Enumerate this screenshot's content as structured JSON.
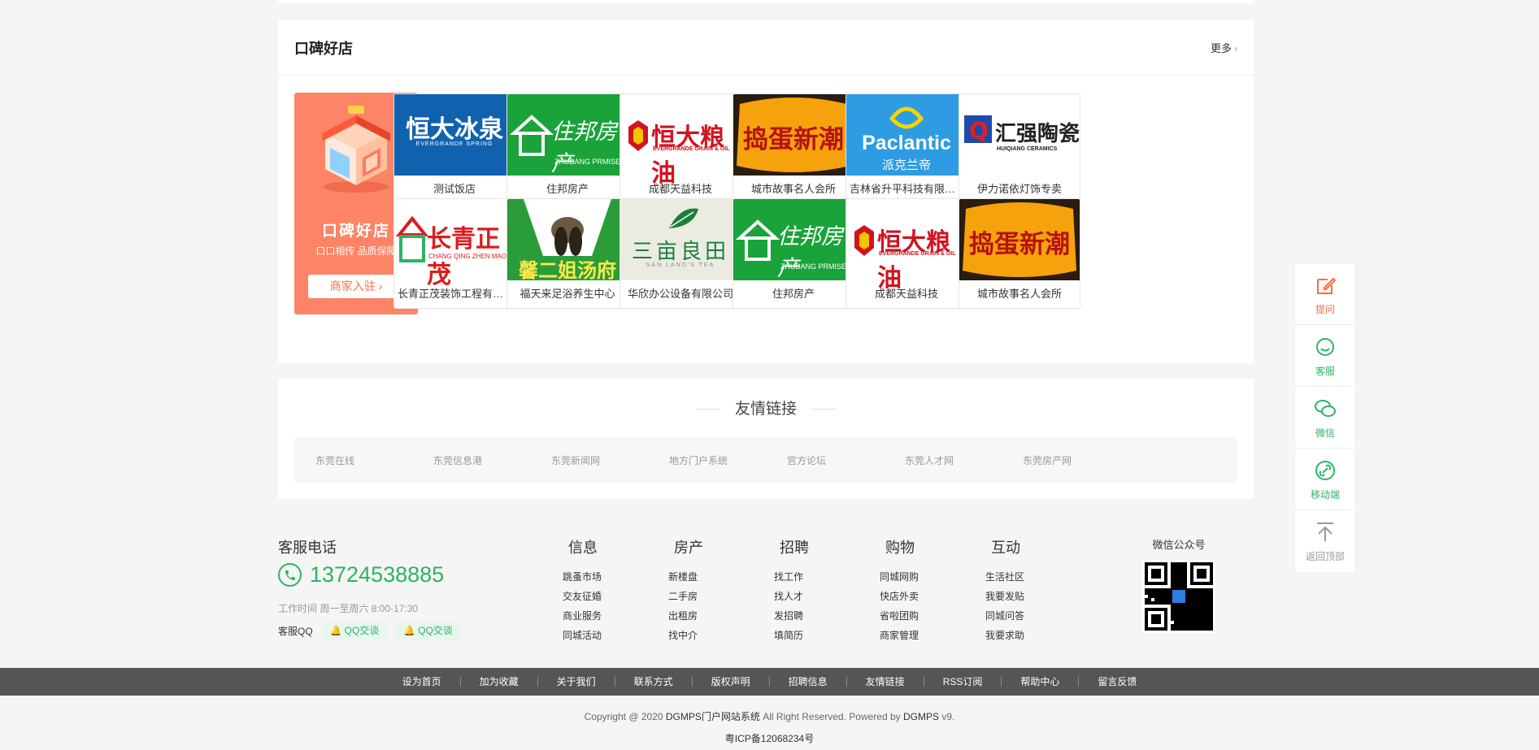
{
  "stores": {
    "title": "口碑好店",
    "more": "更多",
    "promo": {
      "title": "口碑好店",
      "subtitle": "口口相传 品质保障",
      "button": "商家入驻 ›"
    },
    "items": [
      {
        "name": "测试饭店",
        "logo": "恒大冰泉",
        "logo_sub": "EVERGRANDE SPRING",
        "bg": "#1162ae",
        "fg": "#ffffff",
        "kind": "ebq"
      },
      {
        "name": "住邦房产",
        "logo": "住邦房产",
        "logo_sub": "ZHUBANG PRMISES",
        "bg": "#1aa33a",
        "fg": "#ffffff",
        "kind": "zb"
      },
      {
        "name": "成都天益科技",
        "logo": "恒大粮油",
        "logo_sub": "EVERGRANDE GRAIN & OIL",
        "bg": "#ffffff",
        "fg": "#d2131f",
        "kind": "ly"
      },
      {
        "name": "城市故事名人会所",
        "logo": "捣蛋新潮",
        "logo_sub": "",
        "bg": "#f6a20c",
        "fg": "#b5130f",
        "kind": "dd"
      },
      {
        "name": "吉林省升平科技有限公司",
        "logo": "Paclantic",
        "logo_sub": "派克兰帝",
        "bg": "#2e9ce2",
        "fg": "#ffffff",
        "kind": "pc"
      },
      {
        "name": "伊力诺依灯饰专卖",
        "logo": "汇强陶瓷",
        "logo_sub": "HUIQIANG CERAMICS",
        "bg": "#ffffff",
        "fg": "#222222",
        "kind": "hq"
      },
      {
        "name": "长青正茂装饰工程有限公司",
        "logo": "长青正茂",
        "logo_sub": "CHANG QING ZHEN MAO",
        "bg": "#ffffff",
        "fg": "#d81e1e",
        "kind": "cq"
      },
      {
        "name": "福天来足浴养生中心",
        "logo": "馨二姐汤府",
        "logo_sub": "",
        "bg": "#2a9d3a",
        "fg": "#ffe74a",
        "kind": "xe"
      },
      {
        "name": "华欣办公设备有限公司",
        "logo": "三亩良田",
        "logo_sub": "SAN LAND'S TEA",
        "bg": "#ecebe2",
        "fg": "#1c7f3a",
        "kind": "sm"
      },
      {
        "name": "住邦房产",
        "logo": "住邦房产",
        "logo_sub": "ZHUBANG PRMISES",
        "bg": "#1aa33a",
        "fg": "#ffffff",
        "kind": "zb"
      },
      {
        "name": "成都天益科技",
        "logo": "恒大粮油",
        "logo_sub": "EVERGRANDE GRAIN & OIL",
        "bg": "#ffffff",
        "fg": "#d2131f",
        "kind": "ly"
      },
      {
        "name": "城市故事名人会所",
        "logo": "捣蛋新潮",
        "logo_sub": "",
        "bg": "#f6a20c",
        "fg": "#b5130f",
        "kind": "dd"
      }
    ]
  },
  "links": {
    "title": "友情链接",
    "items": [
      "东莞在线",
      "东莞信息港",
      "东莞新闻网",
      "地方门户系统",
      "官方论坛",
      "东莞人才网",
      "东莞房产网"
    ]
  },
  "footer": {
    "hotline_title": "客服电话",
    "phone": "13724538885",
    "work_time": "工作时间 周一至周六 8:00-17:30",
    "qq_label": "客服QQ",
    "qq_buttons": [
      "QQ交谈",
      "QQ交谈"
    ],
    "columns": [
      {
        "title": "信息",
        "items": [
          "跳蚤市场",
          "交友征婚",
          "商业服务",
          "同城活动"
        ]
      },
      {
        "title": "房产",
        "items": [
          "新楼盘",
          "二手房",
          "出租房",
          "找中介"
        ]
      },
      {
        "title": "招聘",
        "items": [
          "找工作",
          "找人才",
          "发招聘",
          "填简历"
        ]
      },
      {
        "title": "购物",
        "items": [
          "同城网购",
          "快店外卖",
          "省啦团购",
          "商家管理"
        ]
      },
      {
        "title": "互动",
        "items": [
          "生活社区",
          "我要发贴",
          "同城问答",
          "我要求助"
        ]
      }
    ],
    "wechat_title": "微信公众号"
  },
  "navbar": [
    "设为首页",
    "加为收藏",
    "关于我们",
    "联系方式",
    "版权声明",
    "招聘信息",
    "友情链接",
    "RSS订阅",
    "帮助中心",
    "留言反馈"
  ],
  "copyright": {
    "prefix": "Copyright @ 2020",
    "site": "DGMPS门户网站系统",
    "middle": "All Right Reserved. Powered by",
    "brand": "DGMPS",
    "version": "v9."
  },
  "icp": "粤ICP备12068234号",
  "sidebar": [
    {
      "label": "提问",
      "icon": "edit-icon",
      "color": "#ff6a3d"
    },
    {
      "label": "客服",
      "icon": "chat-smile-icon",
      "color": "#2bb466"
    },
    {
      "label": "微信",
      "icon": "wechat-icon",
      "color": "#2bb466"
    },
    {
      "label": "移动端",
      "icon": "link-icon",
      "color": "#2bb466"
    },
    {
      "label": "返回顶部",
      "icon": "back-to-top-icon",
      "color": "#999999"
    }
  ]
}
